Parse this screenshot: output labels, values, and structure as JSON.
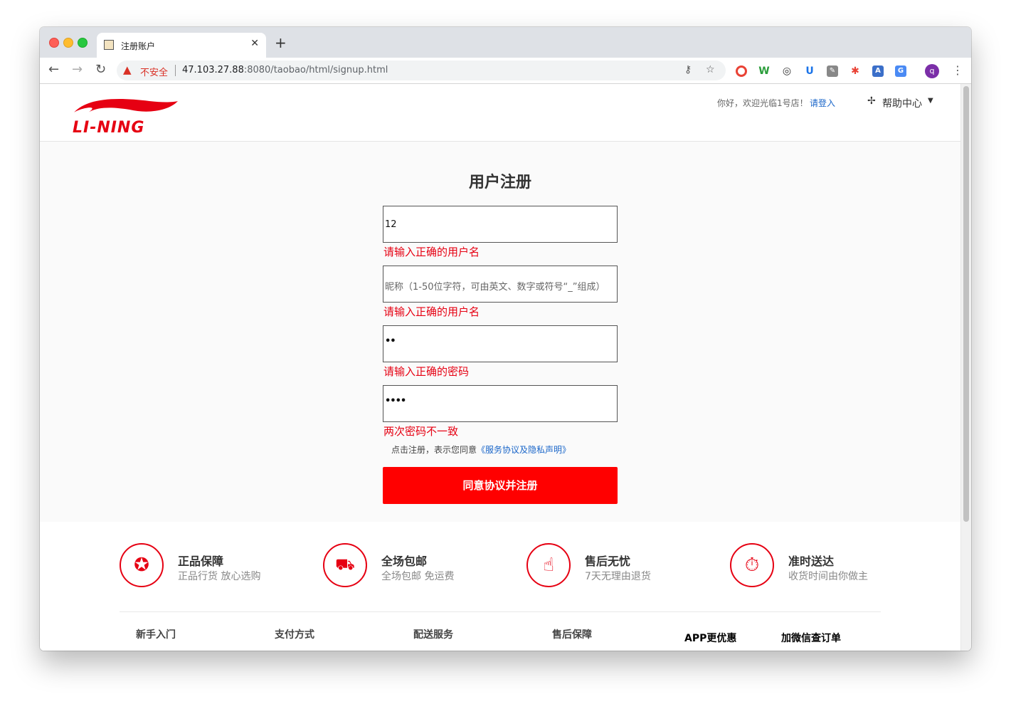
{
  "browser": {
    "tab_title": "注册账户",
    "insecure_label": "不安全",
    "url_host": "47.103.27.88",
    "url_rest": ":8080/taobao/html/signup.html",
    "profile_initial": "q"
  },
  "header": {
    "brand": "LI-NING",
    "welcome": "你好，欢迎光临1号店！",
    "login": "请登入",
    "help": "帮助中心"
  },
  "form": {
    "title": "用户注册",
    "username_value": "12",
    "username_error": "请输入正确的用户名",
    "nickname_placeholder": "昵称（1-50位字符，可由英文、数字或符号“_”组成）",
    "nickname_error": "请输入正确的用户名",
    "password_mask": "••",
    "password_error": "请输入正确的密码",
    "confirm_mask": "••••",
    "confirm_error": "两次密码不一致",
    "agree_prefix": "点击注册，表示您同意",
    "agree_link": "《服务协议及隐私声明》",
    "submit_label": "同意协议并注册"
  },
  "features": [
    {
      "title": "正品保障",
      "subtitle": "正品行货 放心选购",
      "icon": "award-icon"
    },
    {
      "title": "全场包邮",
      "subtitle": "全场包邮 免运费",
      "icon": "free-truck-icon"
    },
    {
      "title": "售后无忧",
      "subtitle": "7天无理由退货",
      "icon": "thumbs-up-icon"
    },
    {
      "title": "准时送达",
      "subtitle": "收货时间由你做主",
      "icon": "stopwatch-icon"
    }
  ],
  "footer_links": [
    "新手入门",
    "支付方式",
    "配送服务",
    "售后保障",
    "APP更优惠",
    "加微信查订单"
  ],
  "colors": {
    "accent": "#ff0000",
    "error": "#e60012",
    "link": "#1a66c9"
  }
}
